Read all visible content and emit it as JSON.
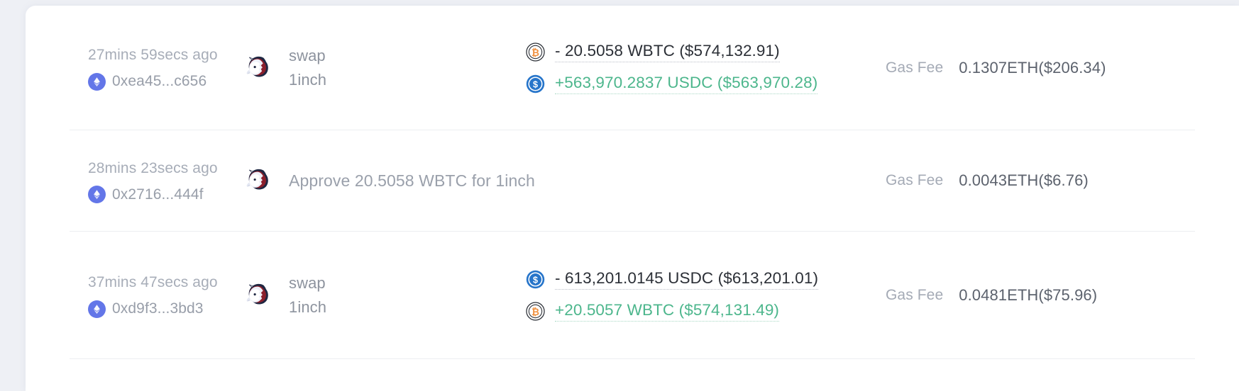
{
  "theme": {
    "page_background": "#eef0f5",
    "card_background": "#ffffff",
    "row_divider": "#eceef1",
    "muted_text": "#a7adb8",
    "dark_text": "#2b2f36",
    "positive_green": "#4cb68c",
    "eth_badge": "#6376e8",
    "usdc_blue": "#2775ca",
    "wbtc_orange": "#f09242"
  },
  "gas_label": "Gas Fee",
  "transactions": [
    {
      "age": "27mins 59secs ago",
      "hash": "0xea45...c656",
      "chain_icon": "ethereum-icon",
      "dapp_icon": "1inch-unicorn-icon",
      "action": "swap",
      "protocol": "1inch",
      "action_single": "",
      "transfers": [
        {
          "token_icon": "wbtc-icon",
          "text": "- 20.5058 WBTC ($574,132.91)",
          "direction": "out"
        },
        {
          "token_icon": "usdc-icon",
          "text": "+563,970.2837 USDC ($563,970.28)",
          "direction": "in"
        }
      ],
      "gas_value": "0.1307ETH($206.34)"
    },
    {
      "age": "28mins 23secs ago",
      "hash": "0x2716...444f",
      "chain_icon": "ethereum-icon",
      "dapp_icon": "1inch-unicorn-icon",
      "action": "",
      "protocol": "",
      "action_single": "Approve 20.5058 WBTC for 1inch",
      "transfers": [],
      "gas_value": "0.0043ETH($6.76)"
    },
    {
      "age": "37mins 47secs ago",
      "hash": "0xd9f3...3bd3",
      "chain_icon": "ethereum-icon",
      "dapp_icon": "1inch-unicorn-icon",
      "action": "swap",
      "protocol": "1inch",
      "action_single": "",
      "transfers": [
        {
          "token_icon": "usdc-icon",
          "text": "- 613,201.0145 USDC ($613,201.01)",
          "direction": "out"
        },
        {
          "token_icon": "wbtc-icon",
          "text": "+20.5057 WBTC ($574,131.49)",
          "direction": "in"
        }
      ],
      "gas_value": "0.0481ETH($75.96)"
    }
  ]
}
